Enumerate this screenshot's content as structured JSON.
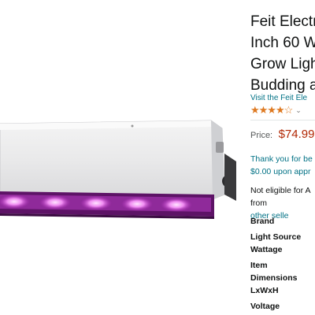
{
  "product": {
    "title_lines": [
      "Feit Electr",
      "Inch 60 W",
      "Grow Ligh",
      "Budding a"
    ],
    "store_link": "Visit the Feit Ele",
    "rating_stars": "★★★★☆",
    "rating_chevron": "⌄",
    "price_label": "Price:",
    "price_value": "$74.99",
    "thanks_lines": [
      "Thank you for be",
      "$0.00 upon appr"
    ],
    "eligible_line": "Not eligible for A",
    "eligible_from": "from",
    "other_sellers": "other selle"
  },
  "specs": [
    "Brand",
    "Light Source",
    "Wattage",
    "Item",
    "Dimensions",
    "LxWxH",
    "Voltage"
  ],
  "colors": {
    "link": "#007185",
    "price": "#b12704",
    "star": "#de7921",
    "grow_light": "#d94fe0"
  },
  "icons": {
    "product_image": "grow-light-fixture-image"
  }
}
